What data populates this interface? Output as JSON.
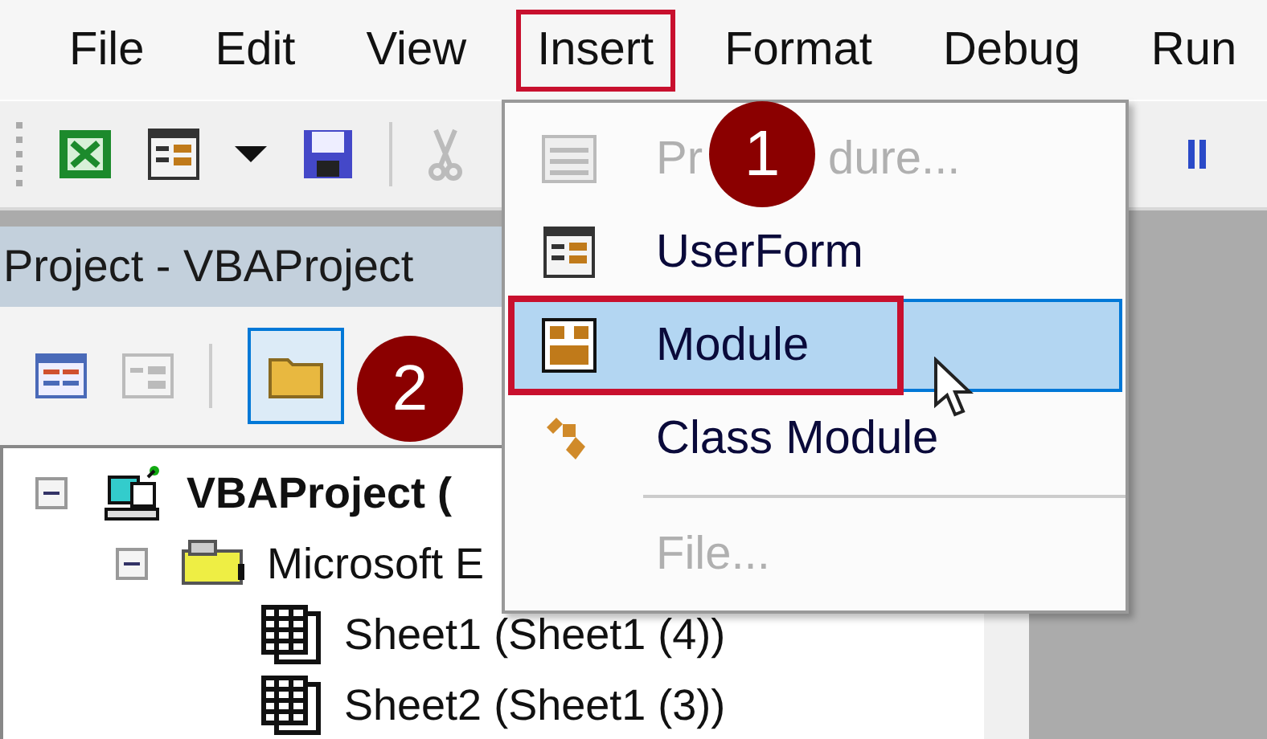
{
  "menu_bar": [
    {
      "label": "File",
      "highlighted": false
    },
    {
      "label": "Edit",
      "highlighted": false
    },
    {
      "label": "View",
      "highlighted": false
    },
    {
      "label": "Insert",
      "highlighted": true
    },
    {
      "label": "Format",
      "highlighted": false
    },
    {
      "label": "Debug",
      "highlighted": false
    },
    {
      "label": "Run",
      "highlighted": false
    }
  ],
  "insert_menu": [
    {
      "kind": "item",
      "label_parts": [
        "Pr",
        "dure..."
      ],
      "disabled": true,
      "selected": false,
      "highlighted": false
    },
    {
      "kind": "item",
      "label_parts": [
        "UserForm"
      ],
      "disabled": false,
      "selected": false,
      "highlighted": false
    },
    {
      "kind": "item",
      "label_parts": [
        "Module"
      ],
      "disabled": false,
      "selected": true,
      "highlighted": true
    },
    {
      "kind": "item",
      "label_parts": [
        "Class Module"
      ],
      "disabled": false,
      "selected": false,
      "highlighted": false
    },
    {
      "kind": "separator"
    },
    {
      "kind": "item",
      "label_parts": [
        "File..."
      ],
      "disabled": true,
      "selected": false,
      "highlighted": false
    }
  ],
  "project_panel": {
    "title": "Project - VBAProject",
    "toggle_folders": {
      "selected": true
    }
  },
  "tree": [
    {
      "label": "VBAProject (",
      "bold": true,
      "expanded": true,
      "children": [
        {
          "label": "Microsoft E",
          "bold": false,
          "expanded": true,
          "children": [
            {
              "label": "Sheet1 (Sheet1 (4))",
              "bold": false
            },
            {
              "label": "Sheet2 (Sheet1 (3))",
              "bold": false
            }
          ]
        }
      ]
    }
  ],
  "callouts": [
    {
      "text": "1"
    },
    {
      "text": "2"
    }
  ]
}
